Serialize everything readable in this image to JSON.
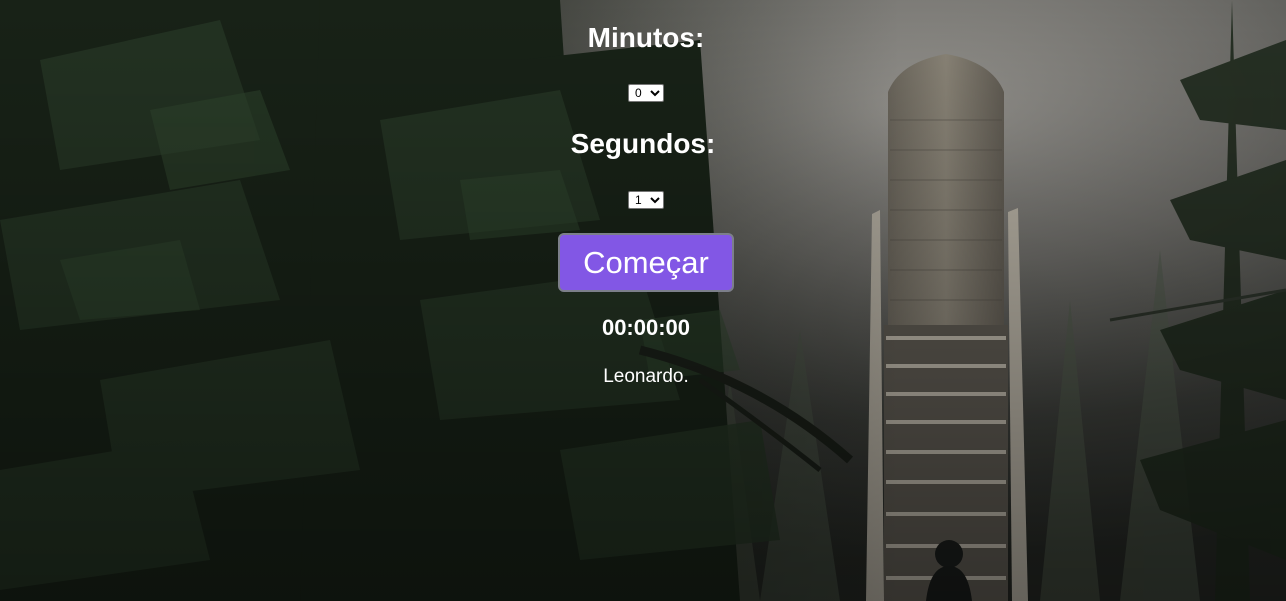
{
  "timer": {
    "minutes_label": "Minutos:",
    "minutes_value": "0",
    "seconds_label": "Segundos:",
    "seconds_value": "1",
    "start_label": "Começar",
    "display": "00:00:00",
    "author": "Leonardo."
  },
  "colors": {
    "accent": "#8257e5",
    "text": "#ffffff"
  },
  "background": {
    "description_icon": "forest-staircase-background"
  }
}
